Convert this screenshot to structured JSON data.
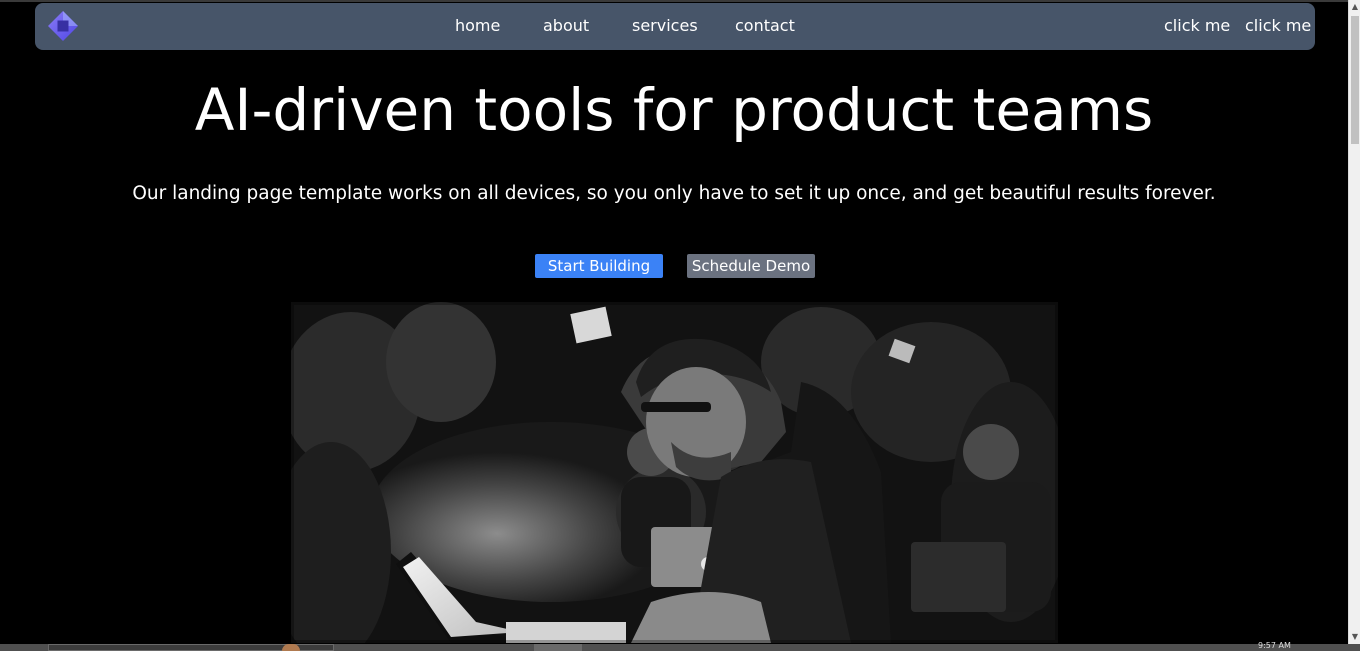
{
  "nav": {
    "logo_icon": "diamond-logo-icon",
    "links": [
      "home",
      "about",
      "services",
      "contact"
    ],
    "actions": [
      "click me",
      "click me"
    ],
    "background": "#475569"
  },
  "hero": {
    "title": "AI-driven tools for product teams",
    "subtitle": "Our landing page template works on all devices, so you only have to set it up once, and get beautiful results forever.",
    "primary_button": "Start Building",
    "secondary_button": "Schedule Demo",
    "primary_color": "#3b82f6",
    "secondary_color": "#6b7280"
  },
  "photo": {
    "icon": "people-working-on-laptops-photo"
  },
  "taskbar": {
    "clock": "9:57 AM"
  }
}
